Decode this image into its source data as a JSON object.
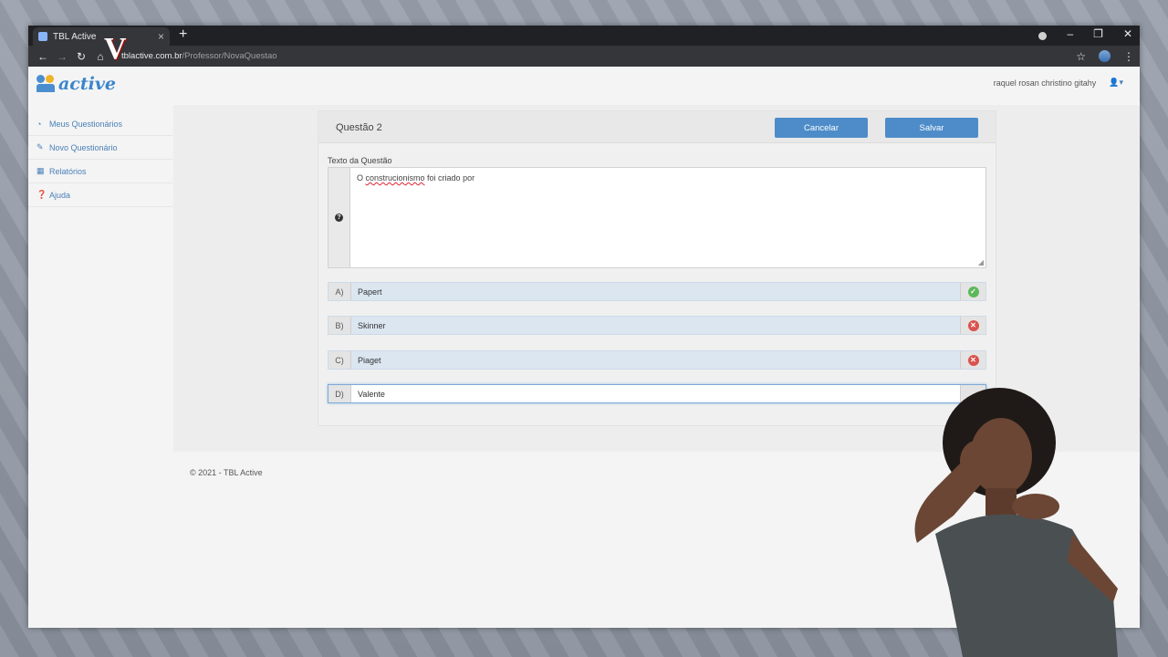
{
  "browser": {
    "tab_title": "TBL Active",
    "url_domain": "tblactive.com.br",
    "url_path": "/Professor/NovaQuestao"
  },
  "app": {
    "logo_text": "active",
    "user_name": "raquel rosan christino gitahy"
  },
  "sidebar": {
    "items": [
      {
        "label": "Meus Questionários",
        "icon": "dashboard-icon"
      },
      {
        "label": "Novo Questionário",
        "icon": "edit-icon"
      },
      {
        "label": "Relatórios",
        "icon": "table-icon"
      },
      {
        "label": "Ajuda",
        "icon": "question-icon"
      }
    ]
  },
  "question": {
    "title": "Questão 2",
    "cancel_label": "Cancelar",
    "save_label": "Salvar",
    "text_label": "Texto da Questão",
    "text_before": "O ",
    "text_misspelled": "construcionismo",
    "text_after": " foi criado por"
  },
  "options": [
    {
      "letter": "A)",
      "value": "Papert",
      "status": "correct"
    },
    {
      "letter": "B)",
      "value": "Skinner",
      "status": "incorrect"
    },
    {
      "letter": "C)",
      "value": "Piaget",
      "status": "incorrect"
    },
    {
      "letter": "D)",
      "value": "Valente",
      "status": "none"
    }
  ],
  "footer": {
    "copyright": "© 2021 - TBL Active"
  },
  "colors": {
    "accent": "#4d8cc9",
    "correct": "#5cb85c",
    "incorrect": "#d9534f"
  }
}
